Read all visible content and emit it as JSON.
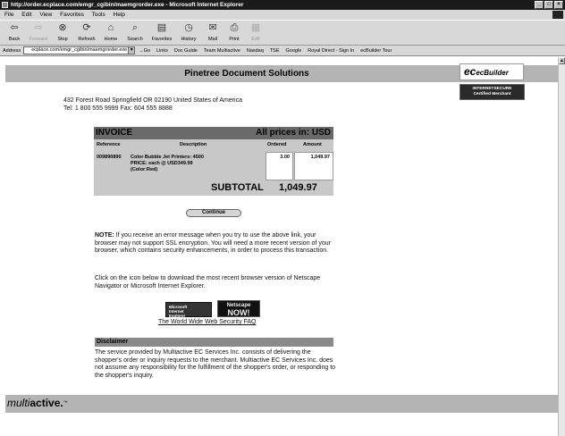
{
  "window": {
    "title": "http://order.ecplace.com/emgr_cgibin/maemgrorder.exe - Microsoft Internet Explorer",
    "controls": [
      "_",
      "□",
      "×"
    ]
  },
  "menu": [
    "File",
    "Edit",
    "View",
    "Favorites",
    "Tools",
    "Help"
  ],
  "toolbar": [
    {
      "label": "Back",
      "icon": "back-arrow-icon",
      "glyph": "⇦"
    },
    {
      "label": "Forward",
      "icon": "forward-arrow-icon",
      "glyph": "⇨",
      "disabled": true
    },
    {
      "label": "Stop",
      "icon": "stop-icon",
      "glyph": "⊗"
    },
    {
      "label": "Refresh",
      "icon": "refresh-icon",
      "glyph": "⟳"
    },
    {
      "label": "Home",
      "icon": "home-icon",
      "glyph": "⌂"
    },
    {
      "label": "Search",
      "icon": "search-icon",
      "glyph": "⌕"
    },
    {
      "label": "Favorites",
      "icon": "favorites-icon",
      "glyph": "▤"
    },
    {
      "label": "History",
      "icon": "history-icon",
      "glyph": "◷"
    },
    {
      "label": "Mail",
      "icon": "mail-icon",
      "glyph": "✉"
    },
    {
      "label": "Print",
      "icon": "print-icon",
      "glyph": "⎙"
    },
    {
      "label": "Edit",
      "icon": "edit-icon",
      "glyph": "▦",
      "disabled": true
    }
  ],
  "address_bar": {
    "label": "Address",
    "url": "ecplace.com/emgr_cgibin/maemgrorder.exe",
    "go_label": "Go",
    "links_label": "Links",
    "links": [
      "Doc Guide",
      "Team Multiactive",
      "Nasdaq",
      "TSE",
      "Google",
      "Royal Direct - Sign In",
      "ecBuilder Tour"
    ]
  },
  "page": {
    "title": "Pinetree Document Solutions",
    "ecbuilder_logo": "ecBuilder",
    "secure_badge": {
      "line1": "INTERNETSECURE",
      "line2": "Certified Merchant"
    },
    "address_line1": "432 Forest Road Springfield OR 02190 United States of America",
    "address_line2": "Tel: 1 800 555 9999 Fax: 604 555 8888",
    "invoice": {
      "heading": "INVOICE",
      "currency_note": "All prices in: USD",
      "columns": {
        "reference": "Reference",
        "description": "Description",
        "ordered": "Ordered",
        "amount": "Amount"
      },
      "row": {
        "reference": "009890890",
        "desc_line1": "Color Bubble Jet Printers: 4500",
        "desc_line2": "PRICE: each @ USD349.99",
        "desc_line3": "(Color:Red)",
        "ordered": "3.00",
        "amount": "1,049.97"
      },
      "subtotal_label": "SUBTOTAL",
      "subtotal_value": "1,049.97"
    },
    "continue_button": "Continue",
    "note_label": "NOTE:",
    "note_text": " If you receive an error message when you try to use the above link, your browser may not support SSL encryption. You will need a more recent version of your browser, which contains security enhancements, in order to process this transaction.",
    "download_text": "Click on the icon below to download the most recent browser version of Netscape Navigator or Microsoft Internet Explorer.",
    "ie_badge": {
      "line1": "Microsoft",
      "line2": "Internet",
      "line3": "Explorer"
    },
    "ns_badge": {
      "line1": "Netscape",
      "line2": "NOW!"
    },
    "faq_link": "The World Wide Web Security FAQ",
    "disclaimer_heading": "Disclaimer",
    "disclaimer_text": "The service provided by Multiactive EC Services Inc. consists of delivering the shopper's order or inquiry requests to the merchant. Multiactive EC Services Inc. does not assume any responsibility for the fulfillment of the shopper's order, or responding to the shopper's inquiry.",
    "footer_logo": {
      "part1": "multi",
      "part2": "active.",
      "tm": "™"
    }
  }
}
